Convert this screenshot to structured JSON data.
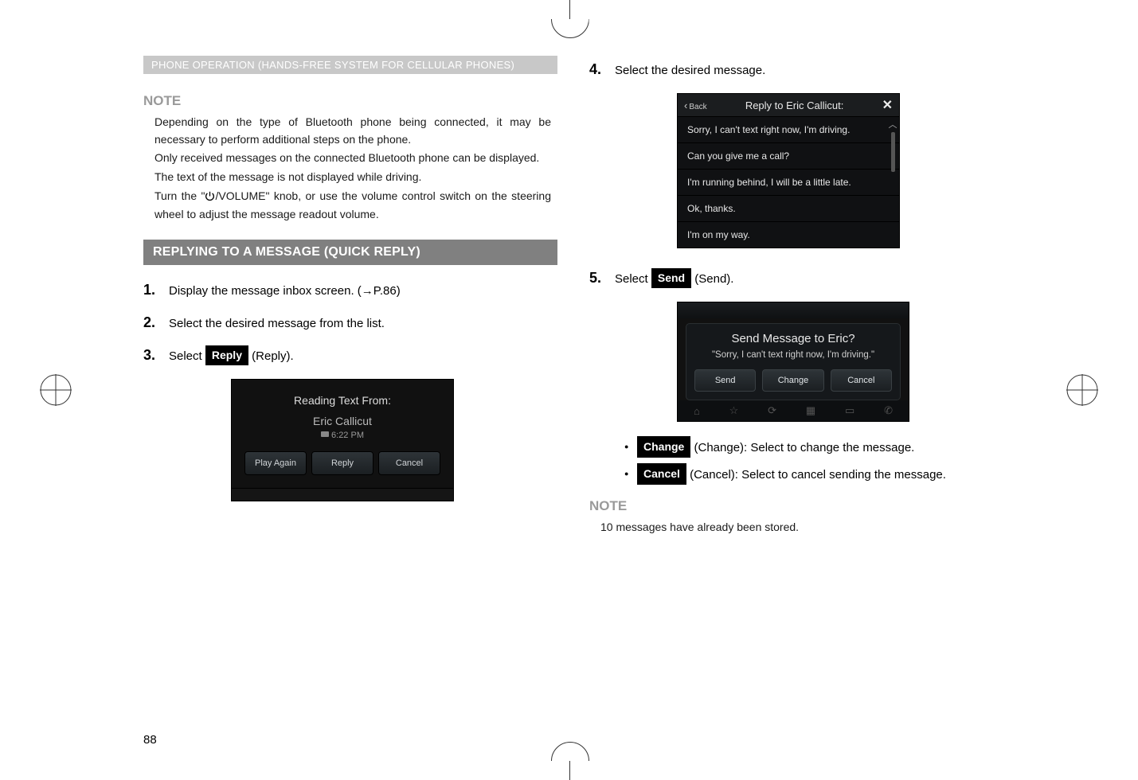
{
  "header_bar": "PHONE OPERATION (HANDS-FREE SYSTEM FOR CELLULAR PHONES)",
  "note_heading": "NOTE",
  "note_lines": {
    "l1": "Depending on the type of Bluetooth phone being connected, it may be necessary to perform additional steps on the phone.",
    "l2": "Only received messages on the connected Bluetooth phone can be displayed.",
    "l3": "The text of the message is not displayed while driving.",
    "l4a": "Turn the \"",
    "l4b": "\" knob, or use the volume control switch on the steering wheel to adjust the message readout volume.",
    "volume_label": "/VOLUME"
  },
  "reply_banner": "REPLYING TO A MESSAGE (QUICK REPLY)",
  "steps_left": {
    "s1": "Display the message inbox screen. (→P.86)",
    "s2": "Select the desired message from the list.",
    "s3a": "Select ",
    "s3_tag": "Reply",
    "s3b": " (Reply)."
  },
  "ss1": {
    "title": "Reading Text From:",
    "name": "Eric Callicut",
    "time": "6:22 PM",
    "b1": "Play Again",
    "b2": "Reply",
    "b3": "Cancel"
  },
  "steps_right": {
    "s4": "Select the desired message.",
    "s5a": "Select ",
    "s5_tag": "Send",
    "s5b": " (Send)."
  },
  "ss2": {
    "back": "Back",
    "title": "Reply to Eric Callicut:",
    "close": "✕",
    "rows": [
      "Sorry, I can't text right now, I'm driving.",
      "Can you give me a call?",
      "I'm running behind, I will be a little late.",
      "Ok, thanks.",
      "I'm on my way."
    ]
  },
  "ss3": {
    "q": "Send Message to Eric?",
    "msg": "\"Sorry, I can't text right now, I'm driving.\"",
    "b1": "Send",
    "b2": "Change",
    "b3": "Cancel"
  },
  "bullets": {
    "change_tag": "Change",
    "change_text": " (Change): Select to change the message.",
    "cancel_tag": "Cancel",
    "cancel_text": " (Cancel): Select to cancel sending the message."
  },
  "note2": "10 messages have already been stored.",
  "page_number": "88"
}
